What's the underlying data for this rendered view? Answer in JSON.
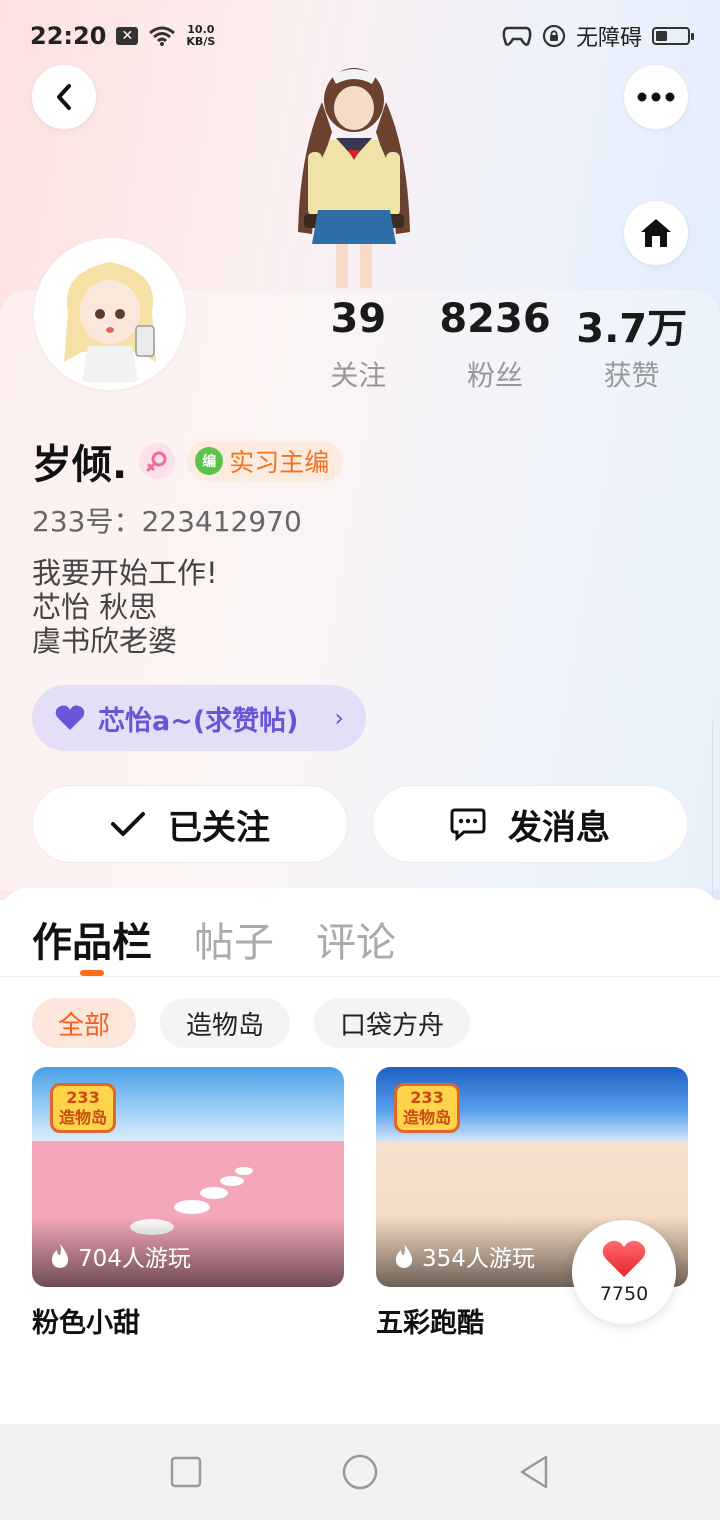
{
  "status_bar": {
    "time": "22:20",
    "network_speed_value": "10.0",
    "network_speed_unit": "KB/S",
    "accessibility_label": "无障碍",
    "battery_level": 0.35
  },
  "profile": {
    "name": "岁倾.",
    "role_badge": "实习主编",
    "role_badge_icon_text": "编",
    "user_id": "233号：223412970",
    "bio_lines": [
      "我要开始工作!",
      "芯怡 秋思",
      "虞书欣老婆"
    ],
    "group_label": "芯怡a~(求赞帖)",
    "stats": [
      {
        "value": "39",
        "label": "关注"
      },
      {
        "value": "8236",
        "label": "粉丝"
      },
      {
        "value": "3.7万",
        "label": "获赞"
      }
    ]
  },
  "actions": {
    "follow_label": "已关注",
    "message_label": "发消息"
  },
  "tabs": [
    {
      "label": "作品栏",
      "active": true
    },
    {
      "label": "帖子",
      "active": false
    },
    {
      "label": "评论",
      "active": false
    }
  ],
  "filters": [
    {
      "label": "全部",
      "active": true
    },
    {
      "label": "造物岛",
      "active": false
    },
    {
      "label": "口袋方舟",
      "active": false
    }
  ],
  "games": [
    {
      "title": "粉色小甜",
      "plays": "704人游玩",
      "logo_top": "233",
      "logo_bottom": "造物岛"
    },
    {
      "title": "五彩跑酷",
      "plays": "354人游玩",
      "logo_top": "233",
      "logo_bottom": "造物岛"
    }
  ],
  "like_count": "7750",
  "colors": {
    "accent_orange": "#f5711e",
    "group_purple": "#6a55d8",
    "like_red": "#ff4d4f"
  }
}
